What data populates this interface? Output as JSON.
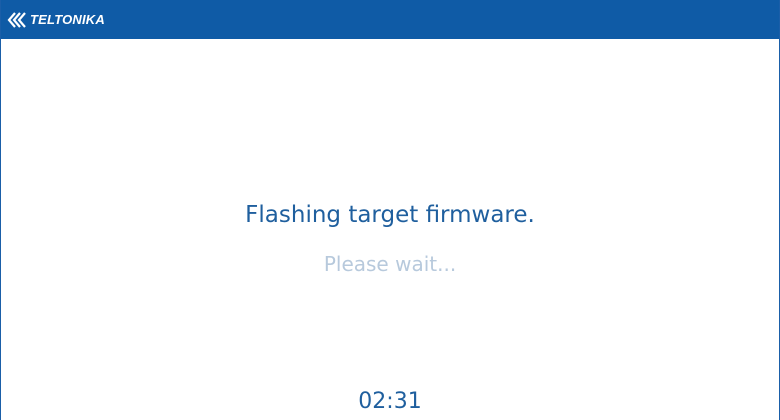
{
  "header": {
    "brand": "TELTONIKA",
    "logo_icon": "teltonika-chevrons-icon",
    "background_color": "#0f5ba6"
  },
  "status": {
    "title": "Flashing target firmware.",
    "subtitle": "Please wait...",
    "title_color": "#1f5f9e",
    "subtitle_color": "#b7c9dc"
  },
  "timer": {
    "value": "02:31"
  }
}
